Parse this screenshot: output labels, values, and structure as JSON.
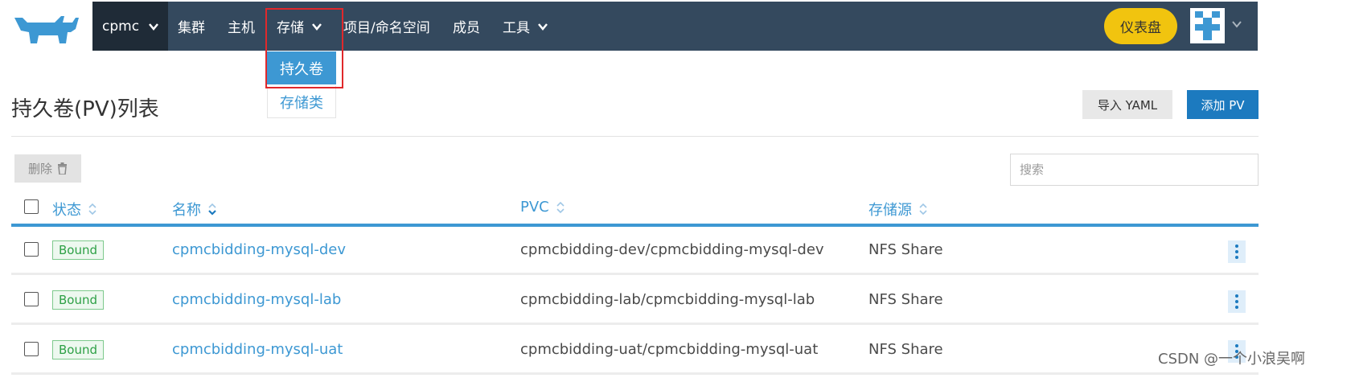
{
  "topnav": {
    "cluster": "cpmc",
    "items": [
      "集群",
      "主机",
      "存储",
      "项目/命名空间",
      "成员",
      "工具"
    ],
    "storage_menu": {
      "selected": "持久卷",
      "other": "存储类"
    },
    "dashboard": "仪表盘"
  },
  "page": {
    "title": "持久卷(PV)列表",
    "import_label": "导入 YAML",
    "add_label": "添加 PV"
  },
  "toolbar": {
    "delete_label": "删除",
    "search_placeholder": "搜索"
  },
  "table": {
    "headers": {
      "state": "状态",
      "name": "名称",
      "pvc": "PVC",
      "source": "存储源"
    },
    "rows": [
      {
        "state": "Bound",
        "name": "cpmcbidding-mysql-dev",
        "pvc": "cpmcbidding-dev/cpmcbidding-mysql-dev",
        "source": "NFS Share"
      },
      {
        "state": "Bound",
        "name": "cpmcbidding-mysql-lab",
        "pvc": "cpmcbidding-lab/cpmcbidding-mysql-lab",
        "source": "NFS Share"
      },
      {
        "state": "Bound",
        "name": "cpmcbidding-mysql-uat",
        "pvc": "cpmcbidding-uat/cpmcbidding-mysql-uat",
        "source": "NFS Share"
      }
    ]
  },
  "watermark": "CSDN @一个小浪吴啊",
  "colors": {
    "nav": "#34495e",
    "accent": "#3d98d3",
    "dashboard": "#f1c40f",
    "highlight_box": "#e0282b",
    "primary_button": "#1c7abf"
  },
  "icons": [
    "cow-logo-icon",
    "chevron-down-icon",
    "trash-icon",
    "sort-icon",
    "kebab-icon"
  ]
}
